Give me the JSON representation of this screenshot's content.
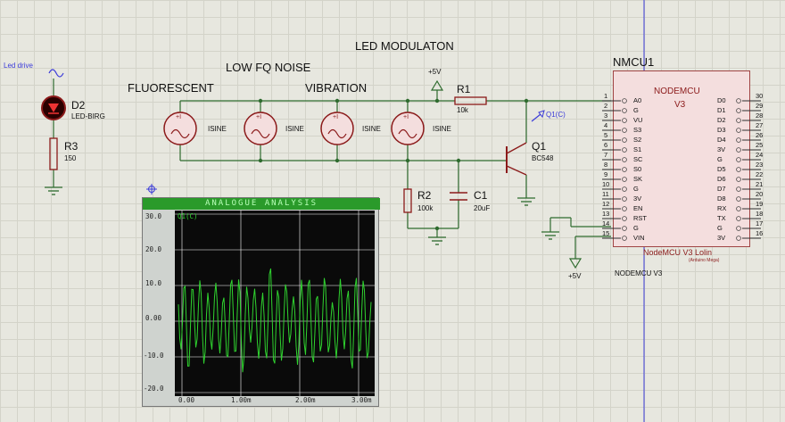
{
  "schematic": {
    "titles": {
      "led_modulaton": "LED MODULATON",
      "low_fq_noise": "LOW FQ NOISE",
      "fluorescent": "FLUORESCENT",
      "vibration": "VIBRATION"
    },
    "led_drive": "Led drive",
    "d2": {
      "ref": "D2",
      "part": "LED-BIRG"
    },
    "r3": {
      "ref": "R3",
      "value": "150"
    },
    "r1": {
      "ref": "R1",
      "value": "10k"
    },
    "r2": {
      "ref": "R2",
      "value": "100k"
    },
    "c1": {
      "ref": "C1",
      "value": "20uF"
    },
    "q1": {
      "ref": "Q1",
      "part": "BC548",
      "probe": "Q1(C)"
    },
    "sources": [
      {
        "symbol": "+I",
        "label": "ISINE"
      },
      {
        "symbol": "+I",
        "label": "ISINE"
      },
      {
        "symbol": "+I",
        "label": "ISINE"
      },
      {
        "symbol": "+I",
        "label": "ISINE"
      }
    ],
    "power": {
      "top": "+5V",
      "bottom": "+5V"
    }
  },
  "mcu": {
    "ref": "NMCU1",
    "chip_title_1": "NODEMCU",
    "chip_title_2": "V3",
    "footer": "NodeMCU V3 Lolin",
    "footer_small": "(Arduino Mega)",
    "part": "NODEMCU V3",
    "left_pins": [
      {
        "num": "1",
        "name": "A0"
      },
      {
        "num": "2",
        "name": "G"
      },
      {
        "num": "3",
        "name": "VU"
      },
      {
        "num": "4",
        "name": "S3"
      },
      {
        "num": "5",
        "name": "S2"
      },
      {
        "num": "6",
        "name": "S1"
      },
      {
        "num": "7",
        "name": "SC"
      },
      {
        "num": "8",
        "name": "S0"
      },
      {
        "num": "9",
        "name": "SK"
      },
      {
        "num": "10",
        "name": "G"
      },
      {
        "num": "11",
        "name": "3V"
      },
      {
        "num": "12",
        "name": "EN"
      },
      {
        "num": "13",
        "name": "RST"
      },
      {
        "num": "14",
        "name": "G"
      },
      {
        "num": "15",
        "name": "VIN"
      }
    ],
    "right_pins": [
      {
        "num": "30",
        "name": "D0"
      },
      {
        "num": "29",
        "name": "D1"
      },
      {
        "num": "28",
        "name": "D2"
      },
      {
        "num": "27",
        "name": "D3"
      },
      {
        "num": "26",
        "name": "D4"
      },
      {
        "num": "25",
        "name": "3V"
      },
      {
        "num": "24",
        "name": "G"
      },
      {
        "num": "23",
        "name": "D5"
      },
      {
        "num": "22",
        "name": "D6"
      },
      {
        "num": "21",
        "name": "D7"
      },
      {
        "num": "20",
        "name": "D8"
      },
      {
        "num": "19",
        "name": "RX"
      },
      {
        "num": "18",
        "name": "TX"
      },
      {
        "num": "17",
        "name": "G"
      },
      {
        "num": "16",
        "name": "3V"
      }
    ]
  },
  "graph": {
    "title": "ANALOGUE ANALYSIS",
    "trace": "Q1(C)",
    "y_ticks": [
      "30.0",
      "20.0",
      "10.0",
      "0.00",
      "-10.0",
      "-20.0"
    ],
    "x_ticks": [
      "0.00",
      "1.00m",
      "2.00m",
      "3.00m"
    ],
    "colors": {
      "trace": "#2fd32f",
      "grid": "#ffffff",
      "background": "#0a0a0a"
    }
  },
  "chart_data": {
    "type": "line",
    "title": "ANALOGUE ANALYSIS",
    "series": [
      {
        "name": "Q1(C)",
        "color": "#2fd32f"
      }
    ],
    "xlim": [
      0,
      3.2
    ],
    "ylim": [
      -20,
      30
    ],
    "x_ticks": [
      "0.00",
      "1.00m",
      "2.00m",
      "3.00m"
    ],
    "y_ticks": [
      "30.0",
      "20.0",
      "10.0",
      "0.00",
      "-10.0",
      "-20.0"
    ],
    "grid": true
  }
}
